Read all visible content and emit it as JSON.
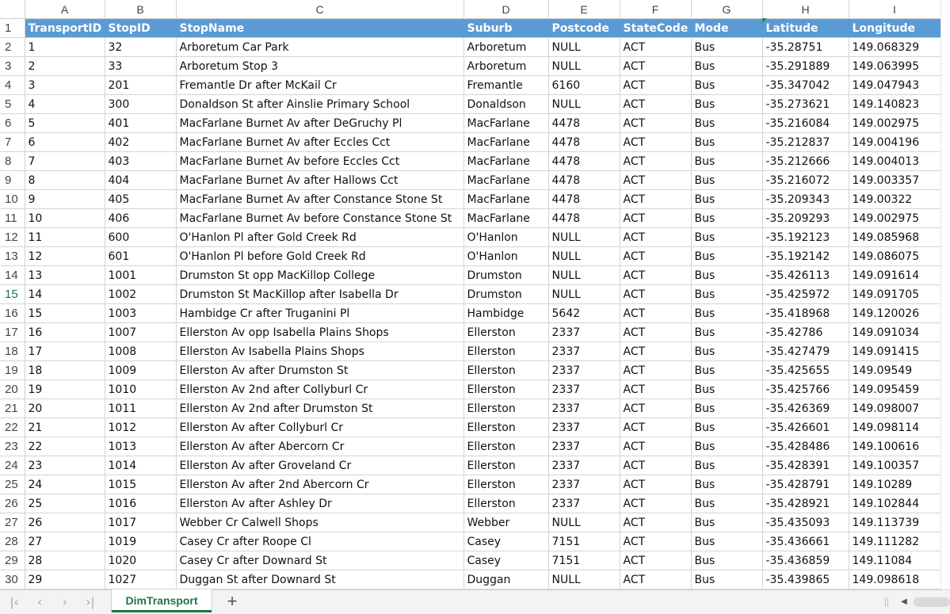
{
  "columns": [
    "A",
    "B",
    "C",
    "D",
    "E",
    "F",
    "G",
    "H",
    "I"
  ],
  "header_row_number": "1",
  "headers": [
    "TransportID",
    "StopID",
    "StopName",
    "Suburb",
    "Postcode",
    "StateCode",
    "Mode",
    "Latitude",
    "Longitude"
  ],
  "rows": [
    {
      "n": "2",
      "cells": [
        "1",
        "32",
        "Arboretum Car Park",
        "Arboretum",
        "NULL",
        "ACT",
        "Bus",
        "-35.28751",
        "149.068329"
      ]
    },
    {
      "n": "3",
      "cells": [
        "2",
        "33",
        "Arboretum Stop 3",
        "Arboretum",
        "NULL",
        "ACT",
        "Bus",
        "-35.291889",
        "149.063995"
      ]
    },
    {
      "n": "4",
      "cells": [
        "3",
        "201",
        "Fremantle Dr after McKail Cr",
        "Fremantle",
        "6160",
        "ACT",
        "Bus",
        "-35.347042",
        "149.047943"
      ]
    },
    {
      "n": "5",
      "cells": [
        "4",
        "300",
        "Donaldson St after Ainslie Primary School",
        "Donaldson",
        "NULL",
        "ACT",
        "Bus",
        "-35.273621",
        "149.140823"
      ]
    },
    {
      "n": "6",
      "cells": [
        "5",
        "401",
        "MacFarlane Burnet Av after DeGruchy Pl",
        "MacFarlane",
        "4478",
        "ACT",
        "Bus",
        "-35.216084",
        "149.002975"
      ]
    },
    {
      "n": "7",
      "cells": [
        "6",
        "402",
        "MacFarlane Burnet Av after Eccles Cct",
        "MacFarlane",
        "4478",
        "ACT",
        "Bus",
        "-35.212837",
        "149.004196"
      ]
    },
    {
      "n": "8",
      "cells": [
        "7",
        "403",
        "MacFarlane Burnet Av before Eccles Cct",
        "MacFarlane",
        "4478",
        "ACT",
        "Bus",
        "-35.212666",
        "149.004013"
      ]
    },
    {
      "n": "9",
      "cells": [
        "8",
        "404",
        "MacFarlane Burnet Av after Hallows Cct",
        "MacFarlane",
        "4478",
        "ACT",
        "Bus",
        "-35.216072",
        "149.003357"
      ]
    },
    {
      "n": "10",
      "cells": [
        "9",
        "405",
        "MacFarlane Burnet Av after Constance Stone St",
        "MacFarlane",
        "4478",
        "ACT",
        "Bus",
        "-35.209343",
        "149.00322"
      ]
    },
    {
      "n": "11",
      "cells": [
        "10",
        "406",
        "MacFarlane Burnet Av before Constance Stone St",
        "MacFarlane",
        "4478",
        "ACT",
        "Bus",
        "-35.209293",
        "149.002975"
      ]
    },
    {
      "n": "12",
      "cells": [
        "11",
        "600",
        "O'Hanlon Pl after Gold Creek Rd",
        "O'Hanlon",
        "NULL",
        "ACT",
        "Bus",
        "-35.192123",
        "149.085968"
      ]
    },
    {
      "n": "13",
      "cells": [
        "12",
        "601",
        "O'Hanlon Pl before Gold Creek Rd",
        "O'Hanlon",
        "NULL",
        "ACT",
        "Bus",
        "-35.192142",
        "149.086075"
      ]
    },
    {
      "n": "14",
      "cells": [
        "13",
        "1001",
        "Drumston St opp MacKillop College",
        "Drumston",
        "NULL",
        "ACT",
        "Bus",
        "-35.426113",
        "149.091614"
      ]
    },
    {
      "n": "15",
      "cells": [
        "14",
        "1002",
        "Drumston St MacKillop after Isabella Dr",
        "Drumston",
        "NULL",
        "ACT",
        "Bus",
        "-35.425972",
        "149.091705"
      ]
    },
    {
      "n": "16",
      "cells": [
        "15",
        "1003",
        "Hambidge Cr after Truganini Pl",
        "Hambidge",
        "5642",
        "ACT",
        "Bus",
        "-35.418968",
        "149.120026"
      ]
    },
    {
      "n": "17",
      "cells": [
        "16",
        "1007",
        "Ellerston Av opp Isabella Plains Shops",
        "Ellerston",
        "2337",
        "ACT",
        "Bus",
        "-35.42786",
        "149.091034"
      ]
    },
    {
      "n": "18",
      "cells": [
        "17",
        "1008",
        "Ellerston Av Isabella Plains Shops",
        "Ellerston",
        "2337",
        "ACT",
        "Bus",
        "-35.427479",
        "149.091415"
      ]
    },
    {
      "n": "19",
      "cells": [
        "18",
        "1009",
        "Ellerston Av after Drumston St",
        "Ellerston",
        "2337",
        "ACT",
        "Bus",
        "-35.425655",
        "149.09549"
      ]
    },
    {
      "n": "20",
      "cells": [
        "19",
        "1010",
        "Ellerston Av 2nd after Collyburl Cr",
        "Ellerston",
        "2337",
        "ACT",
        "Bus",
        "-35.425766",
        "149.095459"
      ]
    },
    {
      "n": "21",
      "cells": [
        "20",
        "1011",
        "Ellerston Av 2nd after Drumston St",
        "Ellerston",
        "2337",
        "ACT",
        "Bus",
        "-35.426369",
        "149.098007"
      ]
    },
    {
      "n": "22",
      "cells": [
        "21",
        "1012",
        "Ellerston Av after Collyburl Cr",
        "Ellerston",
        "2337",
        "ACT",
        "Bus",
        "-35.426601",
        "149.098114"
      ]
    },
    {
      "n": "23",
      "cells": [
        "22",
        "1013",
        "Ellerston Av after Abercorn Cr",
        "Ellerston",
        "2337",
        "ACT",
        "Bus",
        "-35.428486",
        "149.100616"
      ]
    },
    {
      "n": "24",
      "cells": [
        "23",
        "1014",
        "Ellerston Av after Groveland Cr",
        "Ellerston",
        "2337",
        "ACT",
        "Bus",
        "-35.428391",
        "149.100357"
      ]
    },
    {
      "n": "25",
      "cells": [
        "24",
        "1015",
        "Ellerston Av after 2nd Abercorn Cr",
        "Ellerston",
        "2337",
        "ACT",
        "Bus",
        "-35.428791",
        "149.10289"
      ]
    },
    {
      "n": "26",
      "cells": [
        "25",
        "1016",
        "Ellerston Av after Ashley Dr",
        "Ellerston",
        "2337",
        "ACT",
        "Bus",
        "-35.428921",
        "149.102844"
      ]
    },
    {
      "n": "27",
      "cells": [
        "26",
        "1017",
        "Webber Cr Calwell Shops",
        "Webber",
        "NULL",
        "ACT",
        "Bus",
        "-35.435093",
        "149.113739"
      ]
    },
    {
      "n": "28",
      "cells": [
        "27",
        "1019",
        "Casey Cr after Roope Cl",
        "Casey",
        "7151",
        "ACT",
        "Bus",
        "-35.436661",
        "149.111282"
      ]
    },
    {
      "n": "29",
      "cells": [
        "28",
        "1020",
        "Casey Cr after Downard St",
        "Casey",
        "7151",
        "ACT",
        "Bus",
        "-35.436859",
        "149.11084"
      ]
    },
    {
      "n": "30",
      "cells": [
        "29",
        "1027",
        "Duggan St after Downard St",
        "Duggan",
        "NULL",
        "ACT",
        "Bus",
        "-35.439865",
        "149.098618"
      ]
    }
  ],
  "active_row": "15",
  "sheet_tab": {
    "label": "DimTransport"
  },
  "add_sheet_label": "+",
  "nav": {
    "first": "|‹",
    "prev": "‹",
    "next": "›",
    "last": "›|"
  },
  "colors": {
    "header_fill": "#5b9bd5",
    "accent": "#217346"
  }
}
